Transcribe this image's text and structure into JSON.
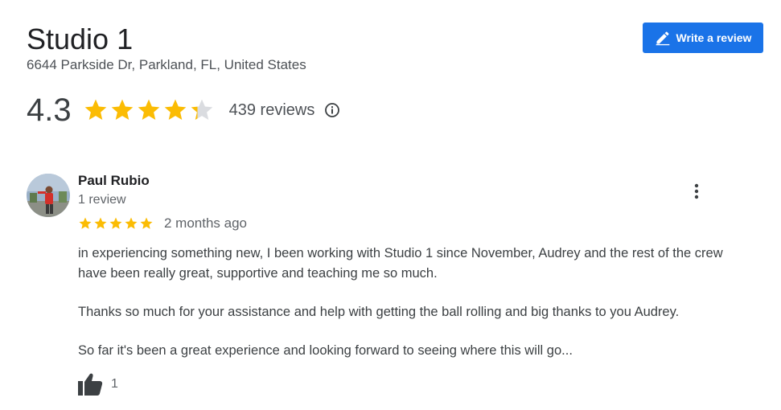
{
  "place": {
    "name": "Studio 1",
    "address": "6644 Parkside Dr, Parkland, FL, United States"
  },
  "actions": {
    "write_review_label": "Write a review",
    "write_review_icon": "pencil-icon"
  },
  "summary": {
    "rating": "4.3",
    "rating_value": 4.3,
    "star_color": "#fbbc04",
    "empty_star_color": "#dadce0",
    "reviews_count_label": "439 reviews",
    "info_icon": "info-icon"
  },
  "review": {
    "reviewer_name": "Paul Rubio",
    "reviewer_meta": "1 review",
    "stars": 5,
    "date": "2 months ago",
    "paragraphs": [
      "in experiencing something new, I been working with Studio 1 since November, Audrey and the rest of the crew have been really great, supportive and teaching me so much.",
      "Thanks so much for your assistance and help with getting the ball rolling and big thanks to you Audrey.",
      "So far it's been a great experience and looking forward to seeing where this will go..."
    ],
    "likes": "1",
    "like_icon": "thumbs-up-icon",
    "more_icon": "more-vert-icon"
  },
  "colors": {
    "accent": "#1a73e8",
    "text_primary": "#202124",
    "text_secondary": "#5f6368"
  }
}
